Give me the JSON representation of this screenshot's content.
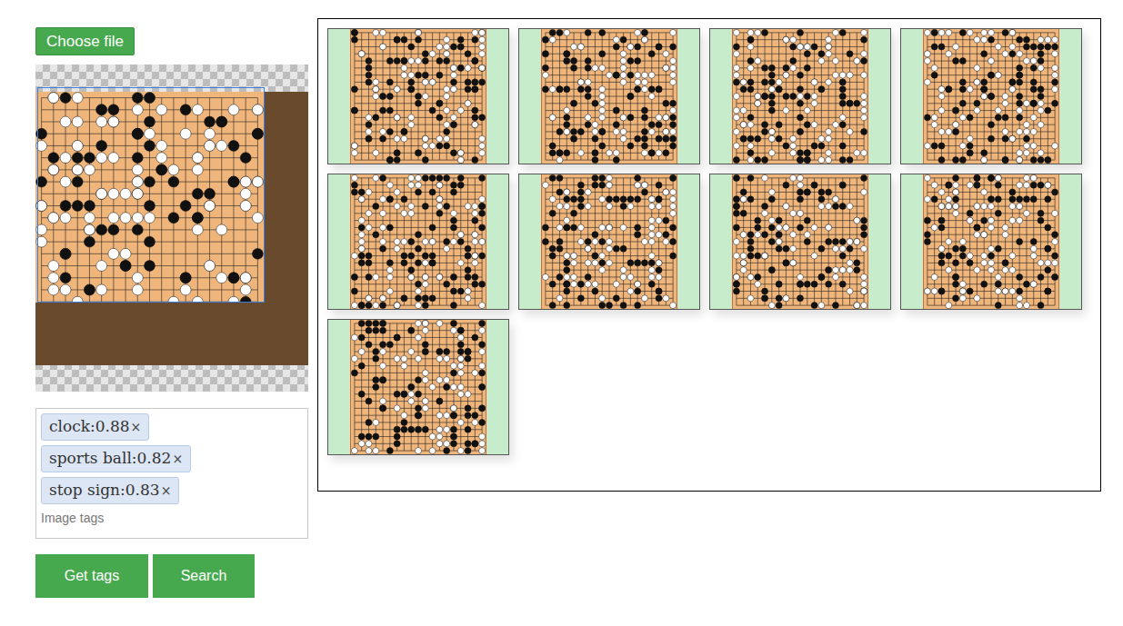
{
  "upload": {
    "label": "Choose file"
  },
  "tags": [
    {
      "label": "clock:0.88",
      "remove": "×"
    },
    {
      "label": "sports ball:0.82",
      "remove": "×"
    },
    {
      "label": "stop sign:0.83",
      "remove": "×"
    }
  ],
  "tag_input": {
    "placeholder": "Image tags"
  },
  "buttons": [
    "Get tags",
    "Search"
  ],
  "results": [
    {
      "kind": "board"
    },
    {
      "kind": "board"
    },
    {
      "kind": "board"
    },
    {
      "kind": "board"
    },
    {
      "kind": "board"
    },
    {
      "kind": "board"
    },
    {
      "kind": "board"
    },
    {
      "kind": "board"
    },
    {
      "kind": "board"
    }
  ]
}
